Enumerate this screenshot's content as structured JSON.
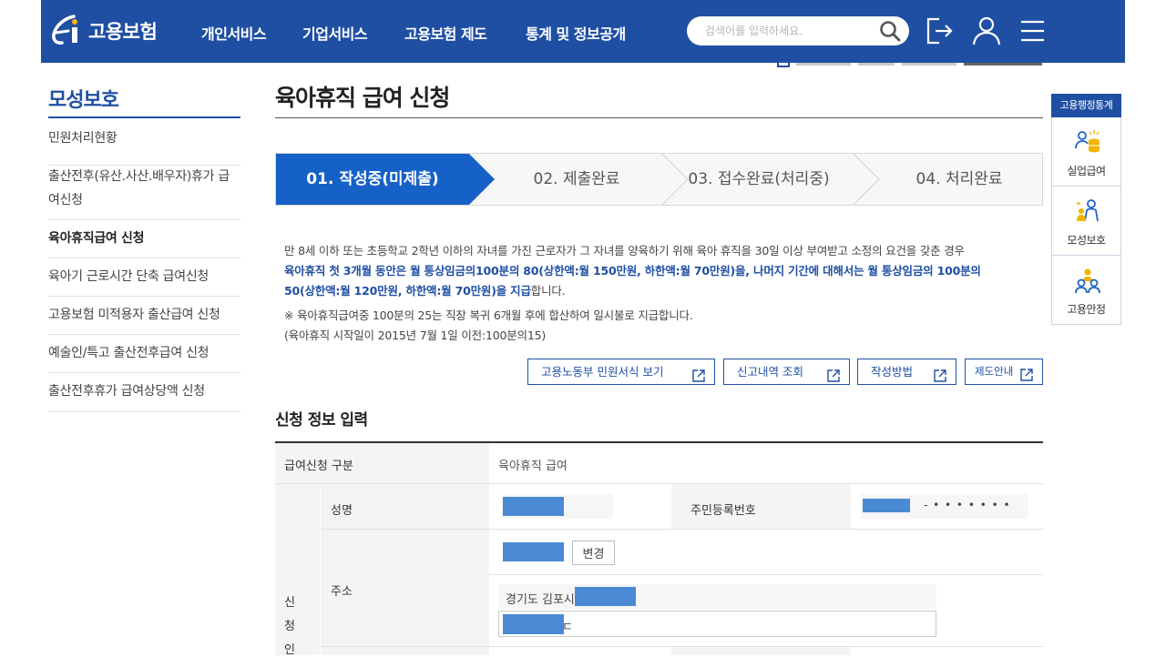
{
  "header": {
    "logo_text": "고용보험",
    "nav": [
      "개인서비스",
      "기업서비스",
      "고용보험 제도",
      "통계 및 정보공개"
    ],
    "search_placeholder": "검색어를 입력하세요."
  },
  "sidebar": {
    "title": "모성보호",
    "items": [
      {
        "label_lines": [
          "민원처리현황"
        ]
      },
      {
        "label_lines": [
          "출산전후(유산.사산.배우자)휴가 급",
          "여신청"
        ]
      },
      {
        "label_lines": [
          "육아휴직급여 신청"
        ],
        "active": true
      },
      {
        "label_lines": [
          "육아기 근로시간 단축 급여신청"
        ]
      },
      {
        "label_lines": [
          "고용보험 미적용자 출산급여 신청"
        ]
      },
      {
        "label_lines": [
          "예술인/특고 출산전후급여 신청"
        ]
      },
      {
        "label_lines": [
          "출산전후휴가 급여상당액 신청"
        ]
      }
    ]
  },
  "main": {
    "title": "육아휴직 급여 신청",
    "steps": [
      {
        "label": "01. 작성중(미제출)",
        "active": true
      },
      {
        "label": "02. 제출완료"
      },
      {
        "label": "03. 접수완료(처리중)"
      },
      {
        "label": "04. 처리완료"
      }
    ],
    "desc": {
      "line1": "만 8세 이하 또는 초등학교 2학년 이하의 자녀를 가진 근로자가 그 자녀를 양육하기 위해 육아 휴직을 30일 이상 부여받고 소정의 요건을 갖춘 경우",
      "line2": "육아휴직 첫 3개월 동안은 월 통상임금의100분의 80(상한액:월 150만원, 하한액:월 70만원)을, 나머지 기간에 대해서는 월 통상임금의 100분의",
      "line3_blue": "50(상한액:월 120만원, 하한액:월 70만원)을 지급",
      "line3_rest": "합니다.",
      "note1": "※ 육아휴직급여중 100분의 25는 직장 복귀 6개월 후에 합산하여 일시불로 지급합니다.",
      "note2": "(육아휴직 시작일이 2015년 7월 1일 이전:100분의15)"
    },
    "buttons": [
      "고용노동부 민원서식 보기",
      "신고내역 조회",
      "작성방법",
      "제도안내"
    ],
    "section_title": "신청 정보 입력",
    "form": {
      "type_label": "급여신청 구분",
      "type_value": "육아휴직 급여",
      "group_label": [
        "신",
        "청",
        "인"
      ],
      "name_label": "성명",
      "rrn_label": "주민등록번호",
      "rrn_mask": "- • • • • • • •",
      "address_label": "주소",
      "change_button": "변경",
      "address_text": "경기도 김포시",
      "address_tail": "ㄷ"
    }
  },
  "quick_panel": {
    "title": "고용행정통계",
    "items": [
      "실업급여",
      "모성보호",
      "고용안정"
    ]
  },
  "colors": {
    "primary": "#1f4fa3",
    "step_active": "#1561c7",
    "redaction": "#4a8ad5"
  }
}
